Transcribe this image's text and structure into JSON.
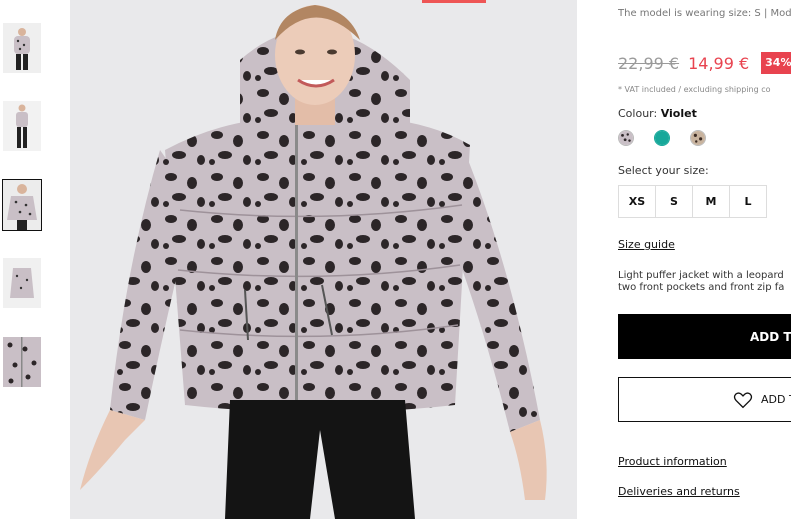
{
  "product": {
    "model_note": "The model is wearing size: S | Mod",
    "old_price": "22,99 €",
    "new_price": "14,99 €",
    "discount": "34%",
    "vat_note": "* VAT included / excluding shipping co",
    "colour_label": "Colour:",
    "colour_value": "Violet",
    "swatches": [
      {
        "name": "leopard-pattern",
        "color": "#c9bfc6"
      },
      {
        "name": "teal",
        "color": "#17a89a"
      },
      {
        "name": "beige-leopard",
        "color": "#c8b39e"
      }
    ],
    "size_label": "Select your size:",
    "sizes": [
      "XS",
      "S",
      "M",
      "L"
    ],
    "size_guide": "Size guide",
    "description_line1": "Light puffer jacket with a leopard",
    "description_line2": "two front pockets and front zip fa",
    "add_to_cart": "ADD TO",
    "add_to_wishlist": "ADD T",
    "product_information": "Product information",
    "deliveries_returns": "Deliveries and returns"
  },
  "colors": {
    "sale_red": "#e8434f",
    "jacket": "#c9bfc6",
    "spots": "#2c2628",
    "background": "#e9e9eb"
  },
  "thumbnails": [
    {
      "name": "thumb-front"
    },
    {
      "name": "thumb-full-body"
    },
    {
      "name": "thumb-pose"
    },
    {
      "name": "thumb-jacket-only"
    },
    {
      "name": "thumb-fabric-detail"
    }
  ]
}
